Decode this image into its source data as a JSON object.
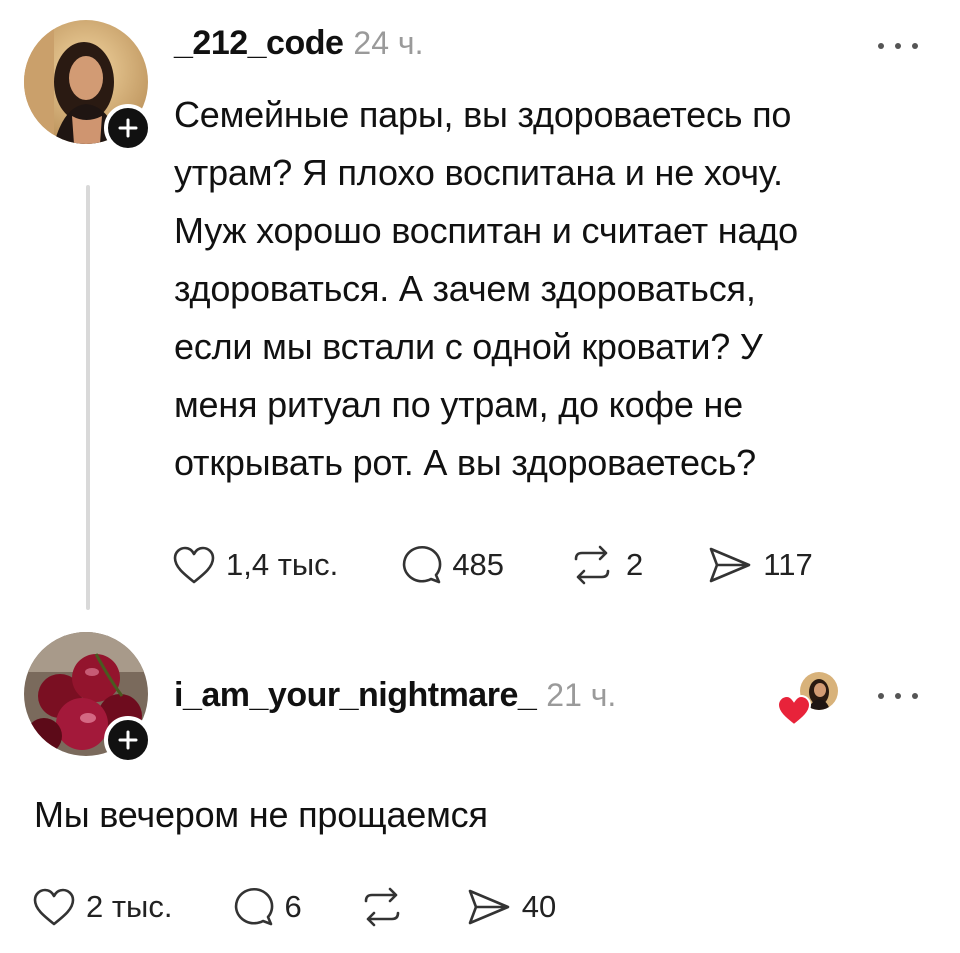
{
  "post": {
    "username": "_212_code",
    "time": "24 ч.",
    "text": "Семейные пары, вы здороваетесь по\nутрам? Я плохо воспитана и не хочу.\nМуж хорошо воспитан и считает надо\nздороваться. А зачем здороваться,\nесли мы встали с одной кровати? У\nменя ритуал по утрам, до кофе не\nоткрывать рот. А вы здороваетесь?",
    "likes": "1,4 тыс.",
    "replies": "485",
    "reposts": "2",
    "shares": "117"
  },
  "reply": {
    "username": "i_am_your_nightmare_",
    "time": "21 ч.",
    "text": "Мы вечером не прощаемся",
    "likes": "2 тыс.",
    "replies": "6",
    "reposts": "",
    "shares": "40"
  },
  "colors": {
    "text": "#111111",
    "muted": "#9a9a9a",
    "heart": "#e8233a",
    "thread_line": "#d9d9d9"
  }
}
